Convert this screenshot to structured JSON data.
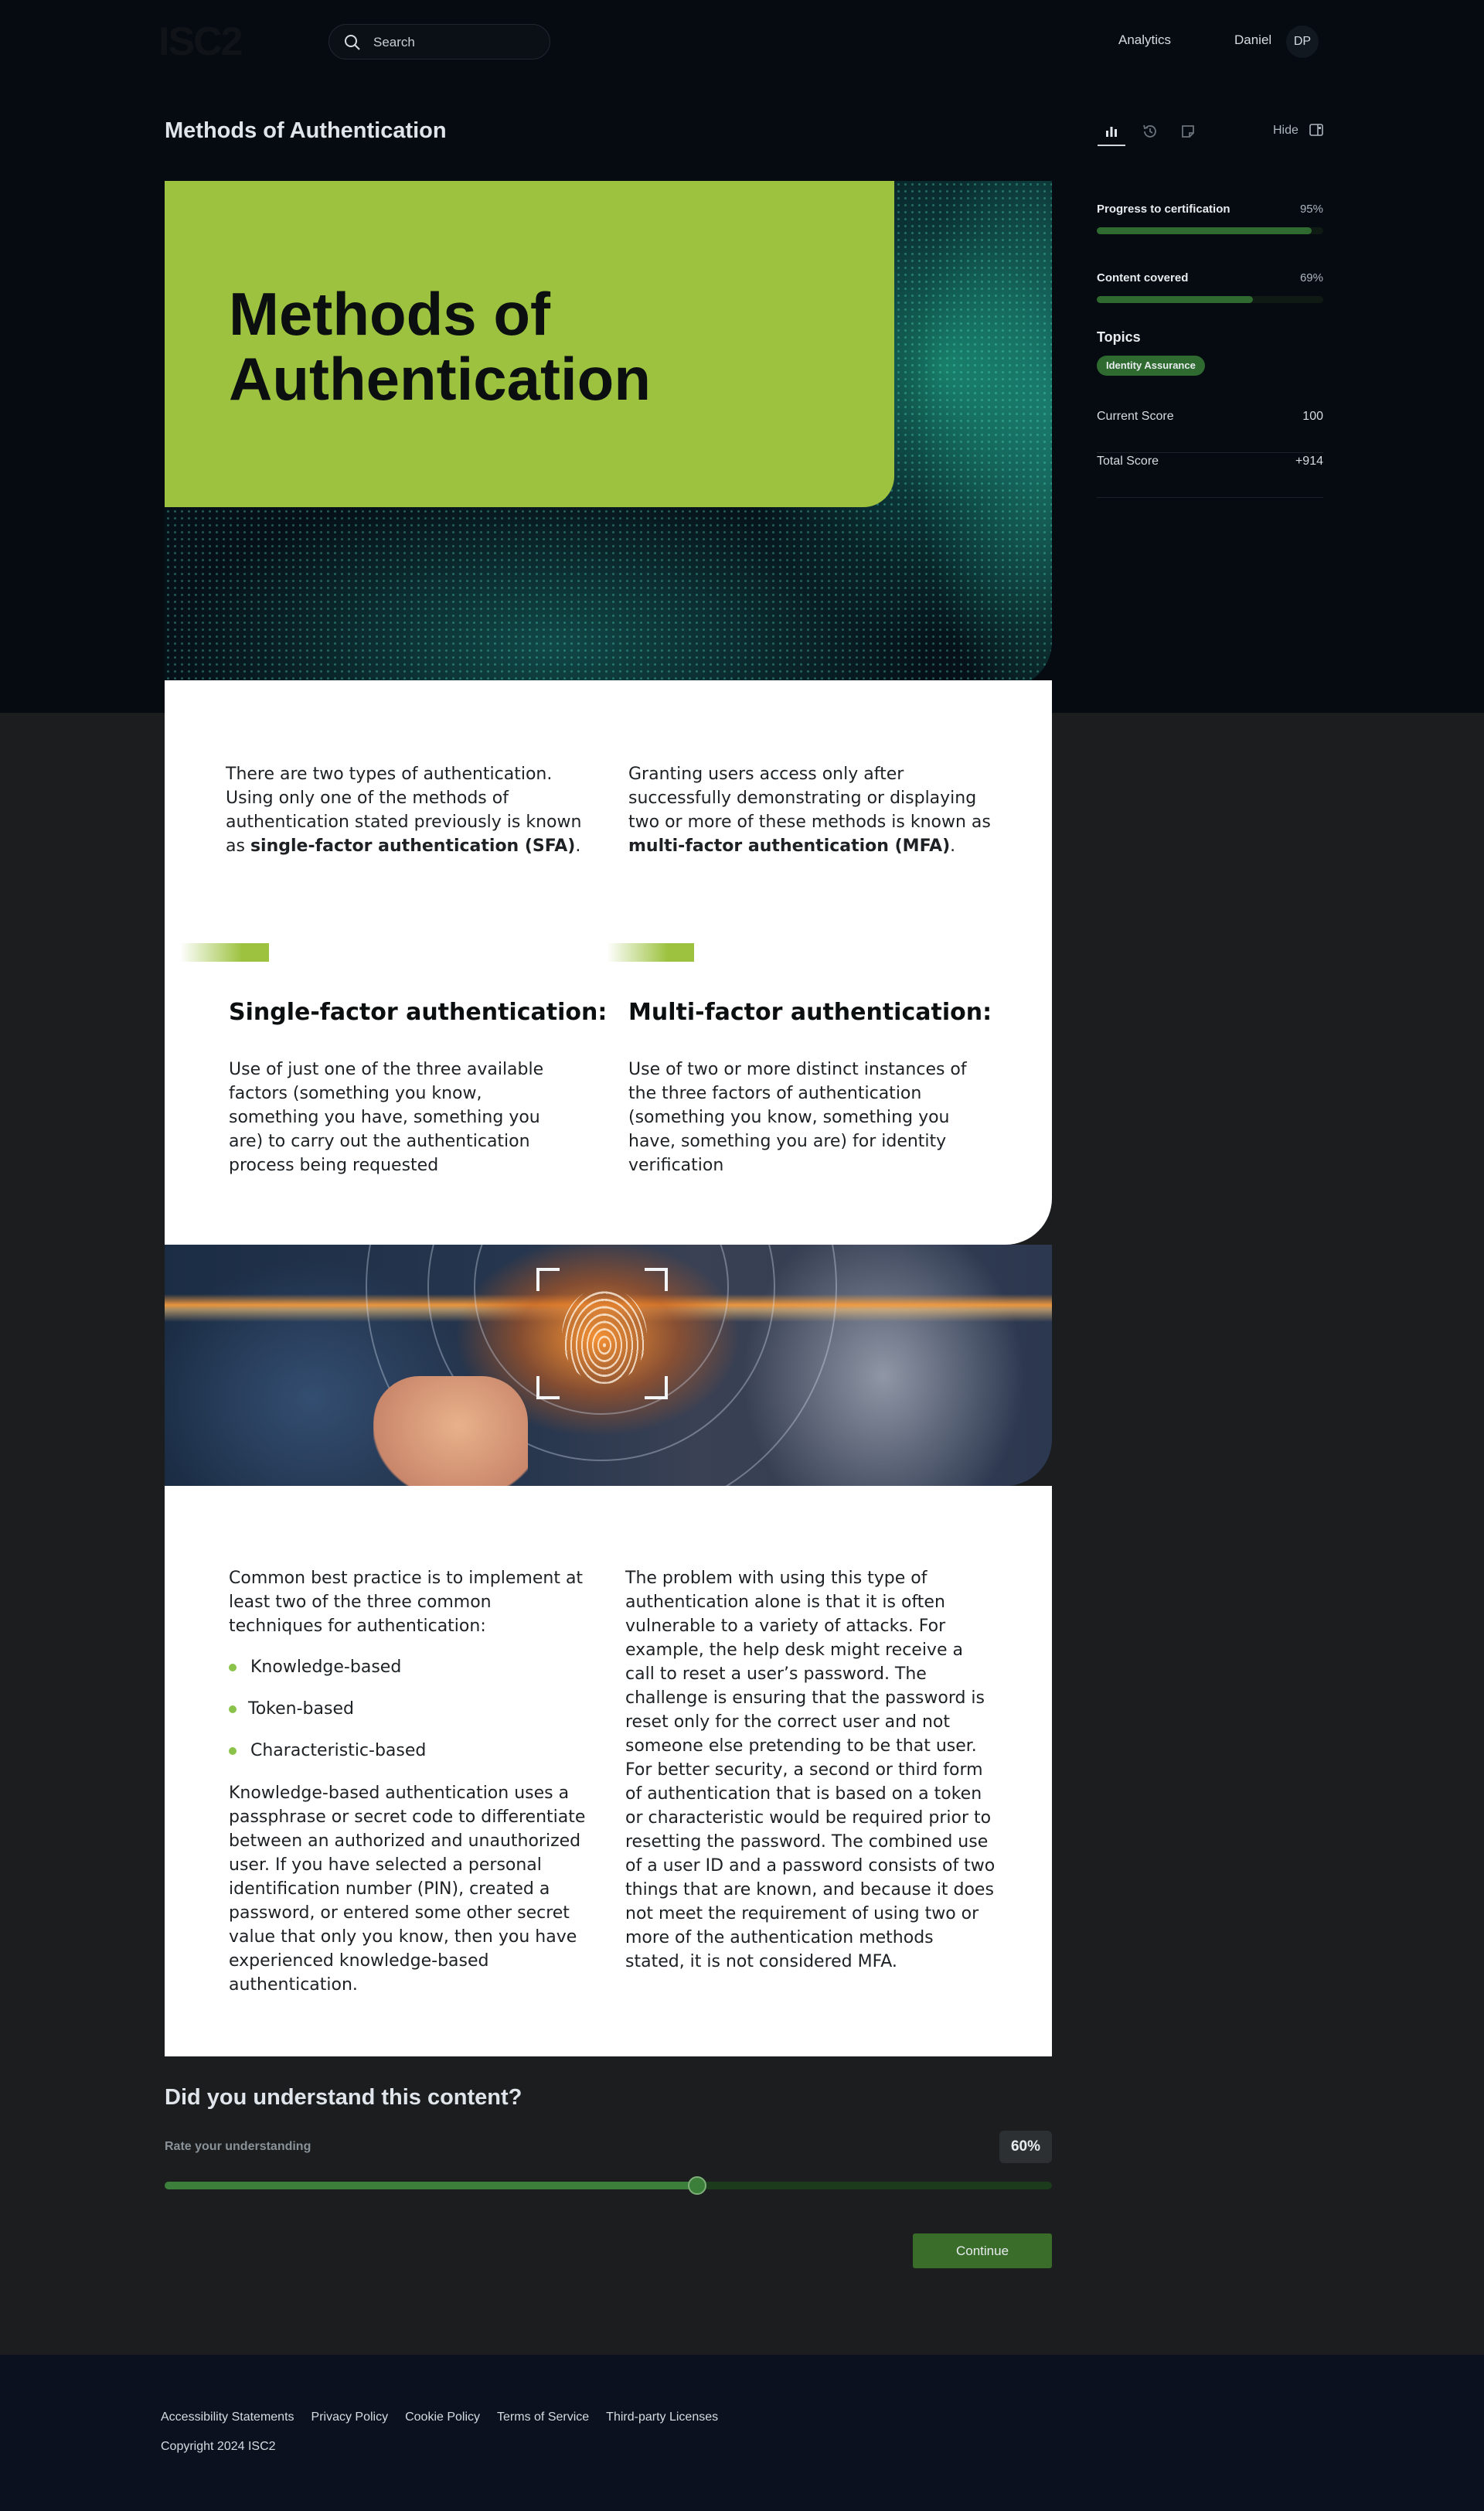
{
  "header": {
    "logo": "ISC2",
    "search_placeholder": "Search",
    "nav_analytics": "Analytics",
    "user_name": "Daniel",
    "user_initials": "DP"
  },
  "page": {
    "title": "Methods of Authentication",
    "hide_label": "Hide"
  },
  "sidebar": {
    "progress_label": "Progress to certification",
    "progress_value": "95%",
    "progress_fraction": 0.95,
    "content_label": "Content covered",
    "content_value": "69%",
    "content_fraction": 0.69,
    "topics_heading": "Topics",
    "topic_badge": "Identity Assurance",
    "current_score_label": "Current Score",
    "current_score_value": "100",
    "total_score_label": "Total Score",
    "total_score_value": "+914"
  },
  "content": {
    "hero_title": "Methods of Authentication",
    "intro_left_1": "There are two types of authentication. Using only one of the methods of authentication stated previously is known as ",
    "intro_left_bold": "single-factor authentication (SFA)",
    "intro_left_2": ".",
    "intro_right_1": "Granting users access only after successfully demonstrating or displaying two or more of these methods is known as ",
    "intro_right_bold": "multi-factor authentication (MFA)",
    "intro_right_2": ".",
    "sfa_heading": "Single-factor authentication:",
    "sfa_text": "Use of just one of the three available factors (something you know, something you have, something you are) to carry out the authentication process being requested",
    "mfa_heading": "Multi-factor authentication:",
    "mfa_text": "Use of two or more distinct instances of the three factors of authentication (something you know, something you have, something you are) for identity verification",
    "practice_intro": "Common best practice is to implement at least two of the three common techniques for authentication:",
    "bullets": [
      "Knowledge-based",
      "Token-based",
      "Characteristic-based"
    ],
    "knowledge_text": "Knowledge-based authentication uses a passphrase or secret code to differentiate between an authorized and unauthorized user. If you have selected a personal identification number (PIN), created a password, or entered some other secret value that only you know, then you have experienced knowledge-based authentication.",
    "problem_text": "The problem with using this type of authentication alone is that it is often vulnerable to a variety of attacks. For example, the help desk might receive a call to reset a user’s password. The challenge is ensuring that the password is reset only for the correct user and not someone else pretending to be that user. For better security, a second or third form of authentication that is based on a token or characteristic would be required prior to resetting the password. The combined use of a user ID and a password consists of two things that are known, and because it does not meet the requirement of using two or more of the authentication methods stated, it is not considered MFA."
  },
  "rating": {
    "question": "Did you understand this content?",
    "label": "Rate your understanding",
    "value_text": "60%",
    "value_fraction": 0.6,
    "continue_label": "Continue"
  },
  "footer": {
    "links": [
      "Accessibility Statements",
      "Privacy Policy",
      "Cookie Policy",
      "Terms of Service",
      "Third-party Licenses"
    ],
    "copyright": "Copyright 2024 ISC2"
  },
  "colors": {
    "accent_green": "#9cc23f",
    "progress_green": "#2f6b30",
    "page_dark": "#060b12",
    "footer": "#0c1120"
  },
  "icons": [
    "search-icon",
    "analytics-icon",
    "history-icon",
    "notes-icon",
    "hide-panel-icon"
  ]
}
